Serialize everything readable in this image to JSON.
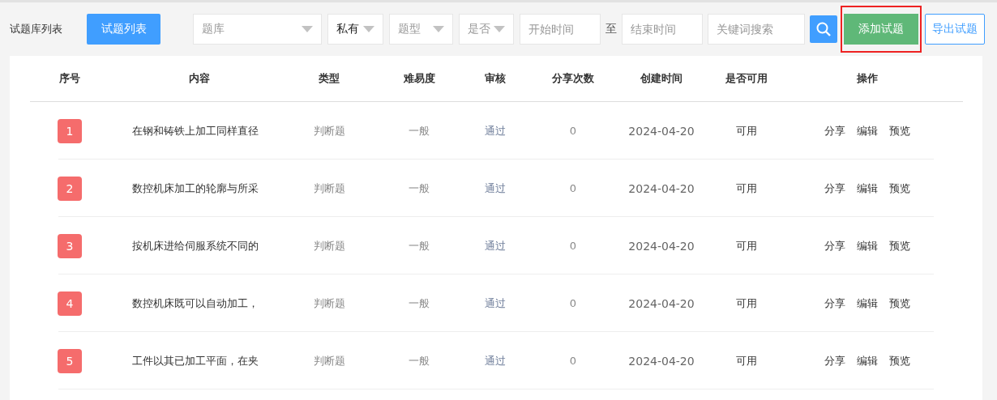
{
  "toolbar": {
    "title": "试题库列表",
    "list_button": "试题列表",
    "filters": [
      {
        "kind": "select",
        "placeholder": "题库"
      },
      {
        "kind": "select",
        "value": "私有"
      },
      {
        "kind": "select",
        "placeholder": "题型"
      },
      {
        "kind": "select",
        "placeholder": "是否"
      },
      {
        "kind": "input",
        "placeholder": "开始时间"
      },
      {
        "kind": "separator",
        "text": "至"
      },
      {
        "kind": "input",
        "placeholder": "结束时间"
      },
      {
        "kind": "input",
        "placeholder": "关键词搜索"
      }
    ],
    "add_button": {
      "label": "添加试题",
      "highlighted": true
    },
    "export_button": "导出试题"
  },
  "table": {
    "columns": [
      "序号",
      "内容",
      "类型",
      "难易度",
      "审核",
      "分享次数",
      "创建时间",
      "是否可用",
      "操作"
    ],
    "rows": [
      {
        "index": "1",
        "content": "在钢和铸铁上加工同样直径",
        "type": "判断题",
        "difficulty": "一般",
        "review": "通过",
        "shares": "0",
        "created": "2024-04-20",
        "available": "可用",
        "actions": [
          "分享",
          "编辑",
          "预览"
        ]
      },
      {
        "index": "2",
        "content": "数控机床加工的轮廓与所采",
        "type": "判断题",
        "difficulty": "一般",
        "review": "通过",
        "shares": "0",
        "created": "2024-04-20",
        "available": "可用",
        "actions": [
          "分享",
          "编辑",
          "预览"
        ]
      },
      {
        "index": "3",
        "content": "按机床进给伺服系统不同的",
        "type": "判断题",
        "difficulty": "一般",
        "review": "通过",
        "shares": "0",
        "created": "2024-04-20",
        "available": "可用",
        "actions": [
          "分享",
          "编辑",
          "预览"
        ]
      },
      {
        "index": "4",
        "content": "数控机床既可以自动加工，",
        "type": "判断题",
        "difficulty": "一般",
        "review": "通过",
        "shares": "0",
        "created": "2024-04-20",
        "available": "可用",
        "actions": [
          "分享",
          "编辑",
          "预览"
        ]
      },
      {
        "index": "5",
        "content": "工件以其已加工平面，在夹",
        "type": "判断题",
        "difficulty": "一般",
        "review": "通过",
        "shares": "0",
        "created": "2024-04-20",
        "available": "可用",
        "actions": [
          "分享",
          "编辑",
          "预览"
        ]
      }
    ]
  }
}
